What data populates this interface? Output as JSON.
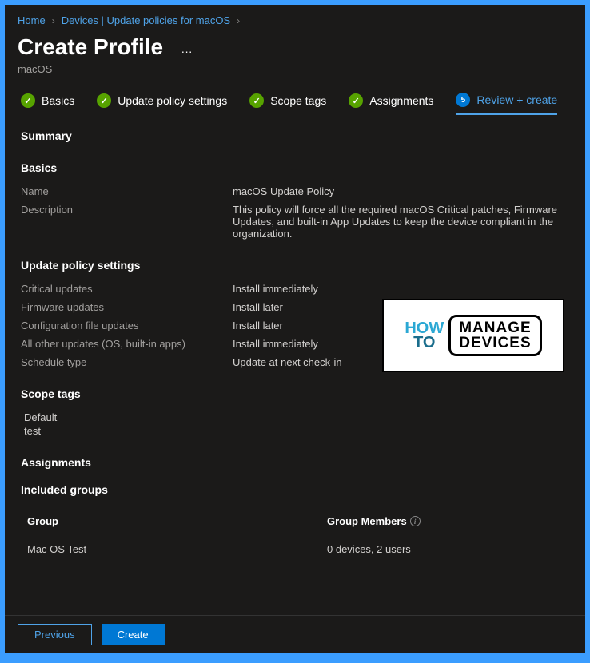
{
  "breadcrumb": {
    "home": "Home",
    "devices": "Devices | Update policies for macOS"
  },
  "header": {
    "title": "Create Profile",
    "subtitle": "macOS"
  },
  "tabs": {
    "basics": "Basics",
    "updatePolicy": "Update policy settings",
    "scopeTags": "Scope tags",
    "assignments": "Assignments",
    "reviewCreate": "Review + create",
    "reviewNumber": "5"
  },
  "summary": {
    "title": "Summary"
  },
  "basics": {
    "heading": "Basics",
    "nameLabel": "Name",
    "nameValue": "macOS Update Policy",
    "descLabel": "Description",
    "descValue": "This policy will force all the required macOS Critical patches, Firmware Updates, and built-in App Updates to keep the device compliant in the organization."
  },
  "updatePolicy": {
    "heading": "Update policy settings",
    "rows": {
      "critical": {
        "label": "Critical updates",
        "value": "Install immediately"
      },
      "firmware": {
        "label": "Firmware updates",
        "value": "Install later"
      },
      "config": {
        "label": "Configuration file updates",
        "value": "Install later"
      },
      "other": {
        "label": "All other updates (OS, built-in apps)",
        "value": "Install immediately"
      },
      "schedule": {
        "label": "Schedule type",
        "value": "Update at next check-in"
      }
    }
  },
  "scopeTags": {
    "heading": "Scope tags",
    "tags": [
      "Default",
      "test"
    ]
  },
  "assignments": {
    "heading": "Assignments",
    "includedHeading": "Included groups",
    "tableHeaders": {
      "group": "Group",
      "members": "Group Members"
    },
    "rows": {
      "row0": {
        "group": "Mac OS Test",
        "members": "0 devices, 2 users"
      }
    }
  },
  "footer": {
    "previous": "Previous",
    "create": "Create"
  },
  "watermark": {
    "how": "HOW",
    "to": "TO",
    "manage": "MANAGE",
    "devices": "DEVICES"
  }
}
